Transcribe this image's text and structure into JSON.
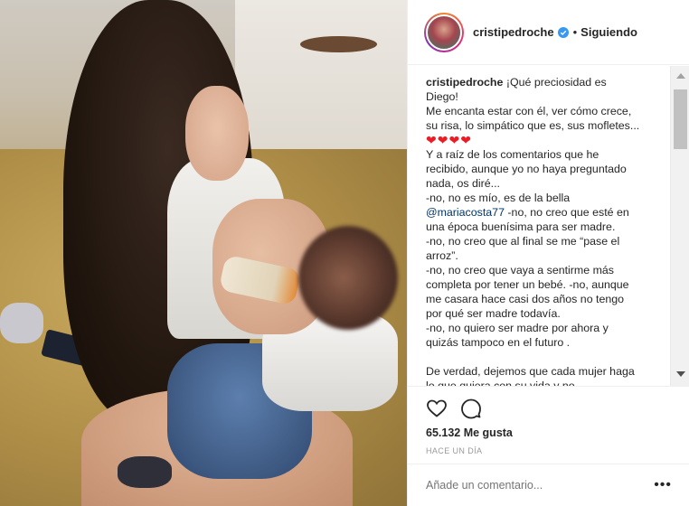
{
  "post": {
    "username": "cristipedroche",
    "follow_status": "Siguiendo",
    "caption_lines": [
      "¡Qué preciosidad es",
      "Diego!",
      "Me encanta estar con él, ver cómo crece,",
      "su risa, lo simpático que es, sus mofletes...",
      "Y a raíz de los comentarios que he",
      "recibido, aunque yo no haya preguntado",
      "nada, os diré...",
      "-no, no es mío, es de la bella",
      "@mariacosta77",
      "-no, no creo que esté en",
      "una época buenísima para ser madre.",
      "-no, no creo que al final se me “pase el",
      "arroz”.",
      "-no, no creo que vaya a sentirme más",
      "completa por tener un bebé. -no, aunque",
      "me casara hace casi dos años no tengo",
      "por qué ser madre todavía.",
      "-no, no quiero ser madre por ahora y",
      "quizás tampoco en el futuro .",
      "De verdad, dejemos que cada mujer haga",
      "lo que quiera con su vida y no..."
    ],
    "hearts": "❤❤❤❤",
    "likes": "65.132 Me gusta",
    "time": "HACE UN DÍA",
    "comment_placeholder": "Añade un comentario...",
    "more_label": "•••"
  },
  "colors": {
    "text": "#262626",
    "link": "#003569",
    "muted": "#999999",
    "verified": "#3897f0",
    "heart": "#ed1b24"
  }
}
